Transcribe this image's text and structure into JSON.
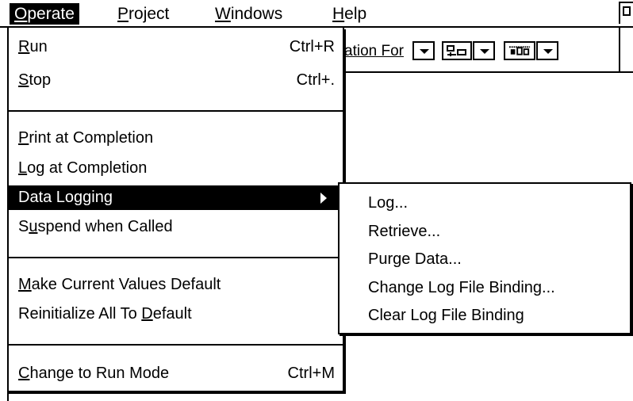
{
  "menubar": {
    "items": [
      {
        "label_html": "<u class=\"mn\">O</u>perate",
        "label": "Operate",
        "active": true
      },
      {
        "label_html": "<u class=\"mn\">P</u>roject",
        "label": "Project",
        "active": false
      },
      {
        "label_html": "<u class=\"mn\">W</u>indows",
        "label": "Windows",
        "active": false
      },
      {
        "label_html": "<u class=\"mn\">H</u>elp",
        "label": "Help",
        "active": false
      }
    ]
  },
  "toolbar": {
    "font_field": "ation For",
    "icons": [
      "text-align-icon",
      "distribute-icon"
    ]
  },
  "operate_menu": {
    "items": [
      {
        "key": "run",
        "label": "Run",
        "mnemonic": "R",
        "shortcut": "Ctrl+R"
      },
      {
        "key": "stop",
        "label": "Stop",
        "mnemonic": "S",
        "shortcut": "Ctrl+."
      },
      {
        "key": "print_at_completion",
        "label": "Print at Completion",
        "mnemonic": "P",
        "shortcut": ""
      },
      {
        "key": "log_at_completion",
        "label": "Log at Completion",
        "mnemonic": "L",
        "shortcut": ""
      },
      {
        "key": "data_logging",
        "label": "Data Logging",
        "mnemonic": "g",
        "shortcut": "",
        "submenu": true,
        "highlighted": true
      },
      {
        "key": "suspend_when_called",
        "label": "Suspend when Called",
        "mnemonic": "u",
        "shortcut": ""
      },
      {
        "key": "make_current_values_default",
        "label": "Make Current Values Default",
        "mnemonic": "M",
        "shortcut": ""
      },
      {
        "key": "reinitialize_all_to_default",
        "label": "Reinitialize All To Default",
        "mnemonic": "D",
        "shortcut": ""
      },
      {
        "key": "change_to_run_mode",
        "label": "Change to Run Mode",
        "mnemonic": "C",
        "shortcut": "Ctrl+M"
      }
    ]
  },
  "data_logging_submenu": {
    "items": [
      {
        "label": "Log..."
      },
      {
        "label": "Retrieve..."
      },
      {
        "label": "Purge Data..."
      },
      {
        "label": "Change Log File Binding..."
      },
      {
        "label": "Clear Log File Binding"
      }
    ]
  },
  "colors": {
    "background": "#ffffff",
    "foreground": "#000000",
    "highlight": "#000000",
    "highlight_text": "#ffffff"
  }
}
